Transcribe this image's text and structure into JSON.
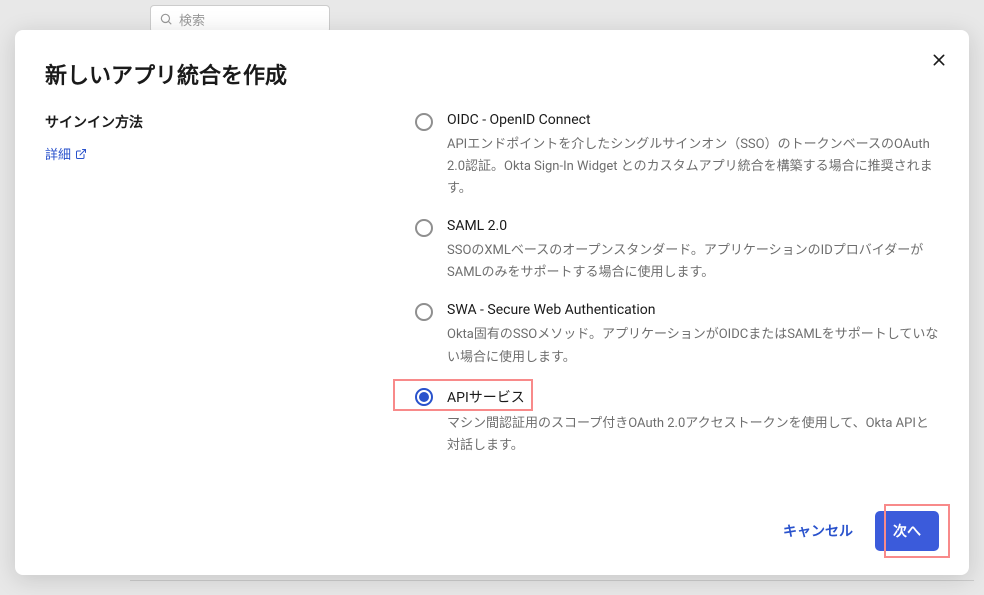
{
  "bg": {
    "search_placeholder": "検索"
  },
  "modal": {
    "title": "新しいアプリ統合を作成",
    "section_label": "サインイン方法",
    "details_link": "詳細",
    "options": [
      {
        "title": "OIDC - OpenID Connect",
        "desc": "APIエンドポイントを介したシングルサインオン（SSO）のトークンベースのOAuth 2.0認証。Okta Sign-In Widget とのカスタムアプリ統合を構築する場合に推奨されます。"
      },
      {
        "title": "SAML 2.0",
        "desc": "SSOのXMLベースのオープンスタンダード。アプリケーションのIDプロバイダーがSAMLのみをサポートする場合に使用します。"
      },
      {
        "title": "SWA - Secure Web Authentication",
        "desc": "Okta固有のSSOメソッド。アプリケーションがOIDCまたはSAMLをサポートしていない場合に使用します。"
      },
      {
        "title": "APIサービス",
        "desc": "マシン間認証用のスコープ付きOAuth 2.0アクセストークンを使用して、Okta APIと対話します。"
      }
    ],
    "selected_index": 3,
    "cancel_label": "キャンセル",
    "next_label": "次へ"
  }
}
